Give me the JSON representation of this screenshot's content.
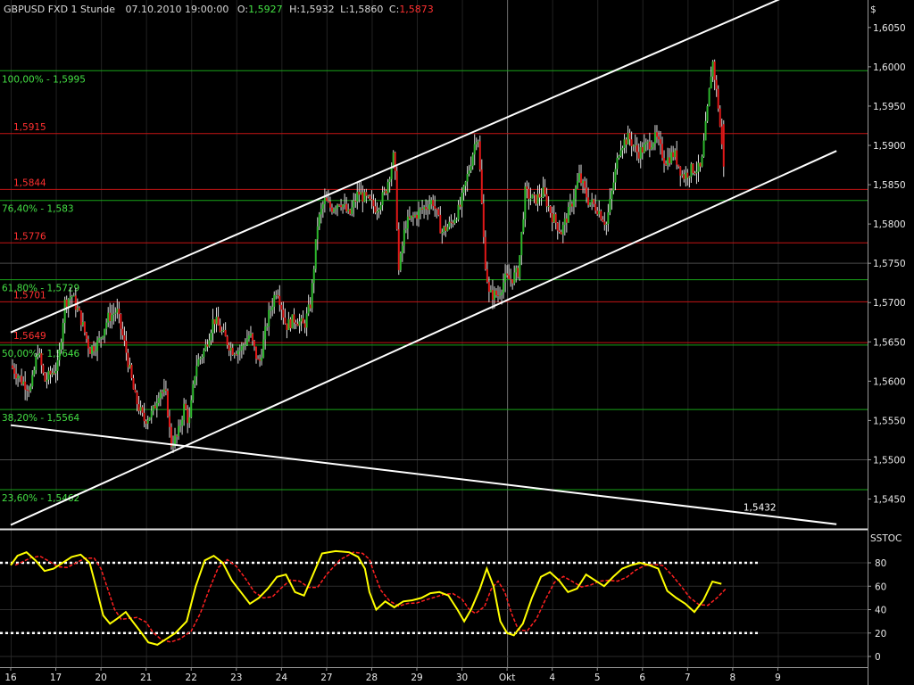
{
  "header": {
    "symbol": "GBPUSD FXD 1 Stunde",
    "datetime": "07.10.2010 19:00:00",
    "open_label": "O:",
    "open": "1,5927",
    "high_label": "H:",
    "high": "1,5932",
    "low_label": "L:",
    "low": "1,5860",
    "close_label": "C:",
    "close": "1,5873"
  },
  "price_axis": {
    "currency": "$",
    "ticks": [
      "1,6050",
      "1,6000",
      "1,5950",
      "1,5900",
      "1,5850",
      "1,5800",
      "1,5750",
      "1,5700",
      "1,5650",
      "1,5600",
      "1,5550",
      "1,5500",
      "1,5450"
    ]
  },
  "oscillator": {
    "title": "SSTOC",
    "ticks": [
      "80",
      "60",
      "40",
      "20",
      "0"
    ],
    "upper_band": 80,
    "lower_band": 20
  },
  "time_axis": [
    "16",
    "17",
    "20",
    "21",
    "22",
    "23",
    "24",
    "27",
    "28",
    "29",
    "30",
    "Okt",
    "4",
    "5",
    "6",
    "7",
    "8",
    "9"
  ],
  "colors": {
    "background": "#000000",
    "up_candle": "#2db82d",
    "down_candle": "#e01818",
    "fib_line": "#19a319",
    "fib_label": "#44e044",
    "level_line": "#c41414",
    "level_label": "#ff3030",
    "stoch_k": "#ffff00",
    "stoch_d": "#ff2020",
    "trend_line": "#ffffff"
  },
  "chart_data": {
    "type": "candlestick",
    "symbol": "GBPUSD",
    "timeframe": "1 Stunde",
    "ylim": [
      1.5412,
      1.6085
    ],
    "x_range": [
      0,
      18
    ],
    "last_bar": {
      "open": 1.5927,
      "high": 1.5932,
      "low": 1.586,
      "close": 1.5873
    },
    "fib_levels": [
      {
        "label": "100,00% - 1,5995",
        "value": 1.5995
      },
      {
        "label": "76,40% - 1,583",
        "value": 1.583
      },
      {
        "label": "61,80% - 1,5729",
        "value": 1.5729
      },
      {
        "label": "50,00% - 1,5646",
        "value": 1.5646
      },
      {
        "label": "38,20% - 1,5564",
        "value": 1.5564
      },
      {
        "label": "23,60% - 1,5462",
        "value": 1.5462
      }
    ],
    "price_levels": [
      {
        "label": "1,5915",
        "value": 1.5915
      },
      {
        "label": "1,5844",
        "value": 1.5844
      },
      {
        "label": "1,5776",
        "value": 1.5776
      },
      {
        "label": "1,5701",
        "value": 1.5701
      },
      {
        "label": "1,5649",
        "value": 1.5649
      }
    ],
    "extra_lines": [
      1.575,
      1.55
    ],
    "trendlines": [
      {
        "name": "channel-top",
        "from": [
          0,
          1.5662
        ],
        "to": [
          17.4,
          1.6095
        ]
      },
      {
        "name": "channel-bottom",
        "from": [
          0,
          1.5417
        ],
        "to": [
          18.3,
          1.5893
        ]
      },
      {
        "name": "falling-line",
        "from": [
          0,
          1.5544
        ],
        "to": [
          18.3,
          1.5418
        ]
      }
    ],
    "trendline_label": {
      "text": "1,5432",
      "x": 16.0,
      "y": 1.5432
    },
    "cursor_x": 11.0,
    "price_path": [
      [
        0.0,
        1.562
      ],
      [
        0.25,
        1.56
      ],
      [
        0.45,
        1.559
      ],
      [
        0.6,
        1.564
      ],
      [
        0.75,
        1.56
      ],
      [
        0.9,
        1.561
      ],
      [
        1.05,
        1.562
      ],
      [
        1.2,
        1.57
      ],
      [
        1.35,
        1.571
      ],
      [
        1.55,
        1.568
      ],
      [
        1.75,
        1.564
      ],
      [
        1.95,
        1.565
      ],
      [
        2.15,
        1.568
      ],
      [
        2.35,
        1.569
      ],
      [
        2.55,
        1.564
      ],
      [
        2.75,
        1.558
      ],
      [
        2.95,
        1.555
      ],
      [
        3.15,
        1.556
      ],
      [
        3.3,
        1.559
      ],
      [
        3.45,
        1.558
      ],
      [
        3.55,
        1.552
      ],
      [
        3.7,
        1.553
      ],
      [
        3.85,
        1.557
      ],
      [
        3.95,
        1.5545
      ],
      [
        4.1,
        1.562
      ],
      [
        4.3,
        1.564
      ],
      [
        4.5,
        1.568
      ],
      [
        4.7,
        1.566
      ],
      [
        4.9,
        1.564
      ],
      [
        5.1,
        1.564
      ],
      [
        5.3,
        1.566
      ],
      [
        5.5,
        1.562
      ],
      [
        5.7,
        1.568
      ],
      [
        5.9,
        1.572
      ],
      [
        6.1,
        1.567
      ],
      [
        6.3,
        1.568
      ],
      [
        6.5,
        1.567
      ],
      [
        6.65,
        1.57
      ],
      [
        6.8,
        1.58
      ],
      [
        6.95,
        1.583
      ],
      [
        7.1,
        1.582
      ],
      [
        7.3,
        1.583
      ],
      [
        7.5,
        1.581
      ],
      [
        7.7,
        1.584
      ],
      [
        7.9,
        1.583
      ],
      [
        8.1,
        1.582
      ],
      [
        8.3,
        1.584
      ],
      [
        8.5,
        1.589
      ],
      [
        8.6,
        1.574
      ],
      [
        8.75,
        1.58
      ],
      [
        8.95,
        1.581
      ],
      [
        9.15,
        1.582
      ],
      [
        9.35,
        1.583
      ],
      [
        9.55,
        1.579
      ],
      [
        9.75,
        1.58
      ],
      [
        9.95,
        1.582
      ],
      [
        10.2,
        1.588
      ],
      [
        10.35,
        1.592
      ],
      [
        10.5,
        1.576
      ],
      [
        10.6,
        1.571
      ],
      [
        10.8,
        1.571
      ],
      [
        10.95,
        1.573
      ],
      [
        11.1,
        1.573
      ],
      [
        11.25,
        1.574
      ],
      [
        11.4,
        1.584
      ],
      [
        11.6,
        1.583
      ],
      [
        11.8,
        1.584
      ],
      [
        12.0,
        1.581
      ],
      [
        12.2,
        1.579
      ],
      [
        12.4,
        1.582
      ],
      [
        12.6,
        1.586
      ],
      [
        12.8,
        1.583
      ],
      [
        13.0,
        1.582
      ],
      [
        13.2,
        1.58
      ],
      [
        13.35,
        1.585
      ],
      [
        13.5,
        1.59
      ],
      [
        13.7,
        1.591
      ],
      [
        13.9,
        1.589
      ],
      [
        14.1,
        1.59
      ],
      [
        14.3,
        1.591
      ],
      [
        14.5,
        1.588
      ],
      [
        14.7,
        1.589
      ],
      [
        14.9,
        1.586
      ],
      [
        15.1,
        1.587
      ],
      [
        15.3,
        1.587
      ],
      [
        15.45,
        1.595
      ],
      [
        15.55,
        1.601
      ],
      [
        15.68,
        1.595
      ],
      [
        15.8,
        1.5873
      ]
    ],
    "stochastic": {
      "k": [
        [
          0.0,
          78
        ],
        [
          0.15,
          86
        ],
        [
          0.35,
          89
        ],
        [
          0.55,
          82
        ],
        [
          0.75,
          73
        ],
        [
          0.95,
          75
        ],
        [
          1.15,
          80
        ],
        [
          1.35,
          85
        ],
        [
          1.55,
          87
        ],
        [
          1.75,
          80
        ],
        [
          1.9,
          58
        ],
        [
          2.05,
          35
        ],
        [
          2.2,
          28
        ],
        [
          2.35,
          32
        ],
        [
          2.55,
          38
        ],
        [
          2.7,
          30
        ],
        [
          2.9,
          20
        ],
        [
          3.05,
          12
        ],
        [
          3.25,
          10
        ],
        [
          3.45,
          15
        ],
        [
          3.65,
          20
        ],
        [
          3.9,
          30
        ],
        [
          4.1,
          60
        ],
        [
          4.3,
          82
        ],
        [
          4.5,
          86
        ],
        [
          4.7,
          80
        ],
        [
          4.9,
          65
        ],
        [
          5.1,
          55
        ],
        [
          5.3,
          45
        ],
        [
          5.5,
          50
        ],
        [
          5.7,
          58
        ],
        [
          5.9,
          68
        ],
        [
          6.1,
          70
        ],
        [
          6.3,
          55
        ],
        [
          6.5,
          52
        ],
        [
          6.7,
          70
        ],
        [
          6.9,
          88
        ],
        [
          7.2,
          90
        ],
        [
          7.5,
          89
        ],
        [
          7.7,
          85
        ],
        [
          7.85,
          75
        ],
        [
          7.95,
          55
        ],
        [
          8.1,
          40
        ],
        [
          8.3,
          47
        ],
        [
          8.5,
          42
        ],
        [
          8.7,
          47
        ],
        [
          8.9,
          48
        ],
        [
          9.1,
          50
        ],
        [
          9.3,
          54
        ],
        [
          9.5,
          55
        ],
        [
          9.7,
          52
        ],
        [
          9.9,
          40
        ],
        [
          10.05,
          30
        ],
        [
          10.2,
          40
        ],
        [
          10.4,
          58
        ],
        [
          10.55,
          75
        ],
        [
          10.7,
          60
        ],
        [
          10.85,
          30
        ],
        [
          11.0,
          20
        ],
        [
          11.15,
          18
        ],
        [
          11.35,
          28
        ],
        [
          11.55,
          50
        ],
        [
          11.75,
          68
        ],
        [
          11.95,
          72
        ],
        [
          12.15,
          65
        ],
        [
          12.35,
          55
        ],
        [
          12.55,
          58
        ],
        [
          12.75,
          70
        ],
        [
          12.95,
          65
        ],
        [
          13.15,
          60
        ],
        [
          13.35,
          68
        ],
        [
          13.55,
          75
        ],
        [
          13.75,
          78
        ],
        [
          13.95,
          80
        ],
        [
          14.15,
          78
        ],
        [
          14.35,
          75
        ],
        [
          14.55,
          56
        ],
        [
          14.75,
          50
        ],
        [
          14.95,
          45
        ],
        [
          15.15,
          38
        ],
        [
          15.35,
          48
        ],
        [
          15.55,
          64
        ],
        [
          15.75,
          62
        ]
      ],
      "d_offset": 0.1
    }
  }
}
